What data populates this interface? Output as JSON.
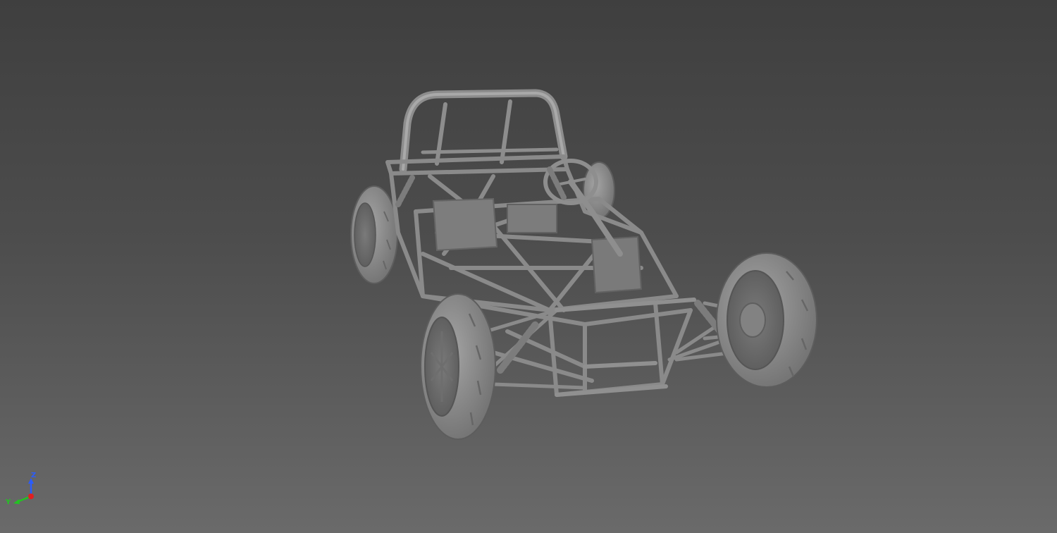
{
  "viewport": {
    "background_top": "#3f3f3f",
    "background_bottom": "#6a6a6a",
    "model_color": "#8e8e8e",
    "model_shadow": "#6b6b6b",
    "model_highlight": "#a8a8a8",
    "model_description_icon": "car-chassis-model"
  },
  "view_triad": {
    "z_label": "Z",
    "y_label": "Y",
    "z_color": "#2a5cff",
    "y_color": "#22c322",
    "x_color": "#e02020"
  }
}
